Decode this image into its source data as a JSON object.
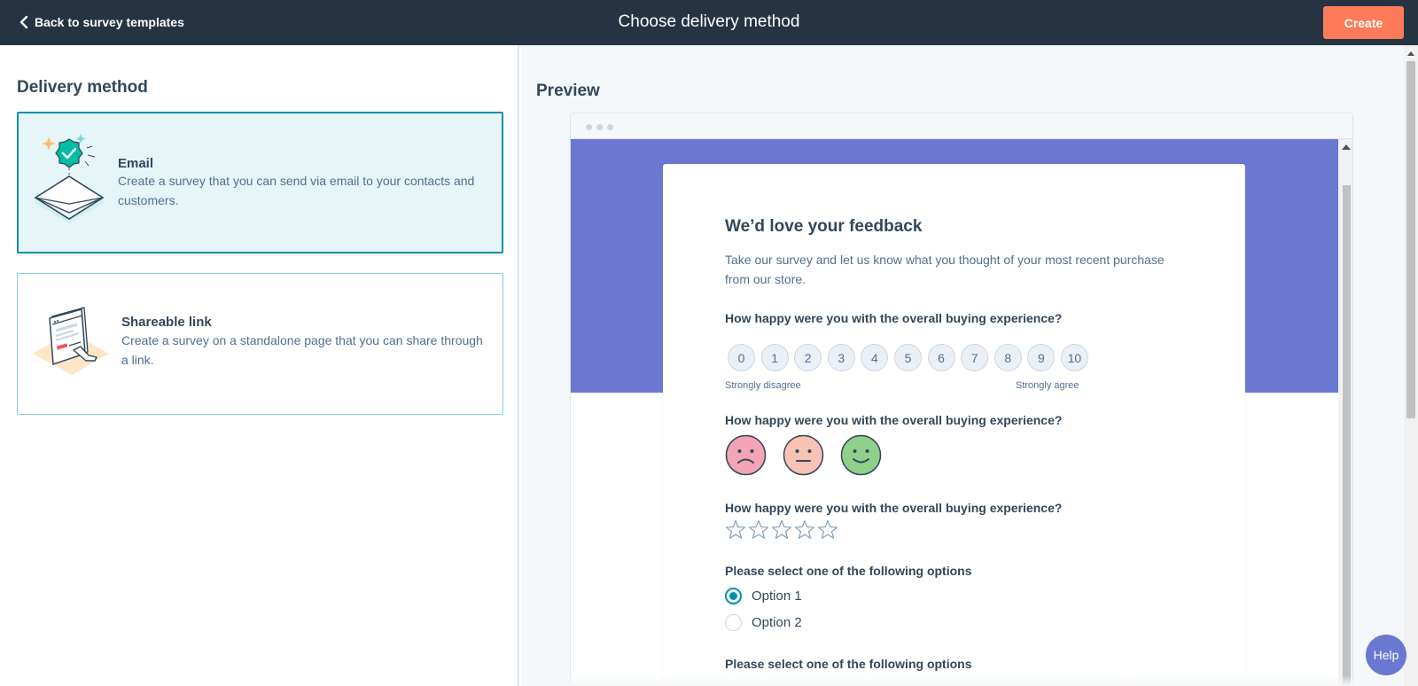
{
  "header": {
    "back_label": "Back to survey templates",
    "title": "Choose delivery method",
    "create_label": "Create"
  },
  "delivery": {
    "section_title": "Delivery method",
    "methods": [
      {
        "title": "Email",
        "description": "Create a survey that you can send via email to your contacts and customers.",
        "selected": true,
        "icon": "email-envelope-illustration"
      },
      {
        "title": "Shareable link",
        "description": "Create a survey on a standalone page that you can share through a link.",
        "selected": false,
        "icon": "shareable-link-illustration"
      }
    ]
  },
  "preview": {
    "title": "Preview",
    "survey": {
      "title": "We’d love your feedback",
      "description": "Take our survey and let us know what you thought of your most recent purchase from our store.",
      "questions": [
        {
          "label": "How happy were you with the overall buying experience?",
          "type": "nps",
          "options": [
            "0",
            "1",
            "2",
            "3",
            "4",
            "5",
            "6",
            "7",
            "8",
            "9",
            "10"
          ],
          "low_label": "Strongly disagree",
          "high_label": "Strongly agree"
        },
        {
          "label": "How happy were you with the overall buying experience?",
          "type": "faces",
          "options": [
            "sad-face-icon",
            "neutral-face-icon",
            "happy-face-icon"
          ]
        },
        {
          "label": "How happy were you with the overall buying experience?",
          "type": "stars",
          "max": 5,
          "rating": 0
        },
        {
          "label": "Please select one of the following options",
          "type": "radio",
          "options": [
            "Option 1",
            "Option 2"
          ],
          "selected": "Option 1"
        },
        {
          "label": "Please select one of the following options",
          "type": "radio"
        }
      ]
    }
  },
  "help_label": "Help",
  "colors": {
    "topbar": "#253342",
    "accent_orange": "#ff7a59",
    "accent_teal": "#0091ae",
    "preview_band": "#6a78d1"
  }
}
